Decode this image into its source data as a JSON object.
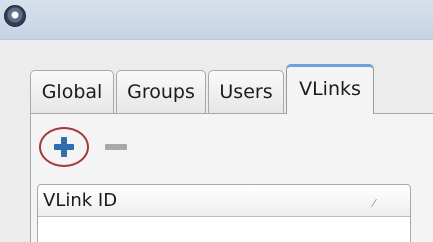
{
  "window": {
    "icon": "app-circle-icon"
  },
  "tabs": [
    {
      "label": "Global",
      "active": false
    },
    {
      "label": "Groups",
      "active": false
    },
    {
      "label": "Users",
      "active": false
    },
    {
      "label": "VLinks",
      "active": true
    }
  ],
  "toolbar": {
    "add_icon": "plus-icon",
    "remove_icon": "minus-icon",
    "add_color": "#2f6fae",
    "highlight_color": "#a33a3a"
  },
  "table": {
    "columns": [
      {
        "label": "VLink ID",
        "sort_glyph": "⁄"
      }
    ],
    "rows": []
  }
}
